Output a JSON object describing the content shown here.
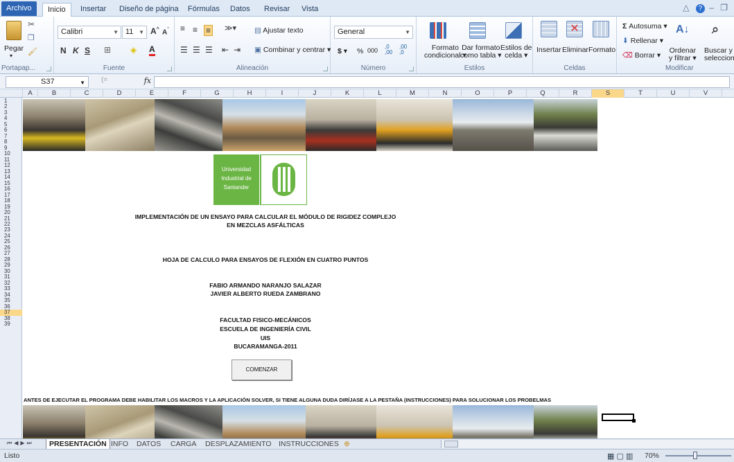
{
  "ribbon_tabs": [
    "Archivo",
    "Inicio",
    "Insertar",
    "Diseño de página",
    "Fórmulas",
    "Datos",
    "Revisar",
    "Vista"
  ],
  "clipboard": {
    "paste": "Pegar",
    "label": "Portapap..."
  },
  "font": {
    "name": "Calibri",
    "size": "11",
    "bold": "N",
    "italic": "K",
    "underline": "S",
    "label": "Fuente"
  },
  "alignment": {
    "wrap": "Ajustar texto",
    "merge": "Combinar y centrar",
    "label": "Alineación"
  },
  "number": {
    "format": "General",
    "currency": "$",
    "percent": "%",
    "thousands": "000",
    "inc_dec": ",0 ,00",
    "dec_dec": ",00 ,0",
    "label": "Número"
  },
  "styles": {
    "conditional_line1": "Formato",
    "conditional_line2": "condicional",
    "table_line1": "Dar formato",
    "table_line2": "como tabla",
    "cell_line1": "Estilos de",
    "cell_line2": "celda",
    "label": "Estilos"
  },
  "cells": {
    "insert": "Insertar",
    "delete": "Eliminar",
    "format": "Formato",
    "label": "Celdas"
  },
  "editing": {
    "autosum": "Autosuma",
    "fill": "Rellenar",
    "clear": "Borrar",
    "sort_line1": "Ordenar",
    "sort_line2": "y filtrar",
    "find_line1": "Buscar y",
    "find_line2": "seleccionar",
    "label": "Modificar"
  },
  "namebox": "S37",
  "fx": "fx",
  "columns": [
    "A",
    "B",
    "C",
    "D",
    "E",
    "F",
    "G",
    "H",
    "I",
    "J",
    "K",
    "L",
    "M",
    "N",
    "O",
    "P",
    "Q",
    "R",
    "S",
    "T",
    "U",
    "V"
  ],
  "selected_column": "S",
  "rows": [
    "1",
    "2",
    "3",
    "4",
    "5",
    "6",
    "7",
    "8",
    "9",
    "10",
    "11",
    "12",
    "13",
    "14",
    "15",
    "16",
    "17",
    "18",
    "19",
    "20",
    "21",
    "22",
    "23",
    "24",
    "25",
    "26",
    "27",
    "28",
    "29",
    "30",
    "31",
    "32",
    "33",
    "34",
    "35",
    "36",
    "37",
    "38",
    "39"
  ],
  "selected_row": "37",
  "logo": {
    "line1": "Universidad",
    "line2": "Industrial de",
    "line3": "Santander",
    "mark": "UIS"
  },
  "content": {
    "title_line1": "IMPLEMENTACIÓN DE UN ENSAYO PARA CALCULAR  EL MÓDULO DE RIGIDEZ COMPLEJO",
    "title_line2": "EN MEZCLAS ASFÁLTICAS",
    "subtitle": "HOJA DE CALCULO PARA ENSAYOS DE FLEXIÓN EN CUATRO PUNTOS",
    "author1": "FABIO ARMANDO NARANJO SALAZAR",
    "author2": "JAVIER ALBERTO RUEDA ZAMBRANO",
    "faculty": "FACULTAD FISICO-MECÁNICOS",
    "school": "ESCUELA DE INGENIERÍA CIVIL",
    "university": "UIS",
    "place": "BUCARAMANGA-2011",
    "button": "COMENZAR",
    "warning": "ANTES DE EJECUTAR EL PROGRAMA DEBE HABILITAR LOS MACROS Y LA APLICACIÓN SOLVER, SI TIENE ALGUNA DUDA DIRÍJASE A LA PESTAÑA (INSTRUCCIONES) PARA SOLUCIONAR LOS PROBELMAS"
  },
  "sheet_tabs": [
    "PRESENTACIÓN",
    "INFO",
    "DATOS",
    "CARGA",
    "DESPLAZAMIENTO",
    "INSTRUCCIONES"
  ],
  "active_sheet": "PRESENTACIÓN",
  "status": {
    "ready": "Listo",
    "zoom": "70%"
  },
  "colors": {
    "uis_green": "#6bb544",
    "selection": "#fbd78a",
    "file_tab": "#2d64b3"
  }
}
